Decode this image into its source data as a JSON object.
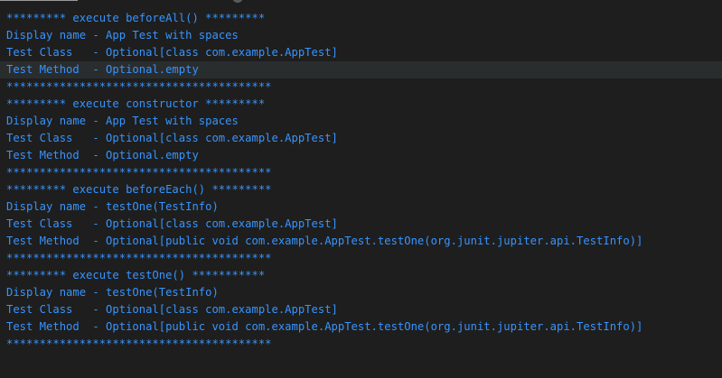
{
  "output": {
    "lines": [
      "********* execute beforeAll() *********",
      "Display name - App Test with spaces",
      "Test Class   - Optional[class com.example.AppTest]",
      "Test Method  - Optional.empty",
      "****************************************",
      "********* execute constructor *********",
      "Display name - App Test with spaces",
      "Test Class   - Optional[class com.example.AppTest]",
      "Test Method  - Optional.empty",
      "****************************************",
      "********* execute beforeEach() *********",
      "Display name - testOne(TestInfo)",
      "Test Class   - Optional[class com.example.AppTest]",
      "Test Method  - Optional[public void com.example.AppTest.testOne(org.junit.jupiter.api.TestInfo)]",
      "****************************************",
      "********* execute testOne() ***********",
      "Display name - testOne(TestInfo)",
      "Test Class   - Optional[class com.example.AppTest]",
      "Test Method  - Optional[public void com.example.AppTest.testOne(org.junit.jupiter.api.TestInfo)]",
      "****************************************"
    ]
  },
  "colors": {
    "background": "#1e1e1e",
    "text": "#3794ff",
    "highlight_row": "#2a2d2e"
  }
}
